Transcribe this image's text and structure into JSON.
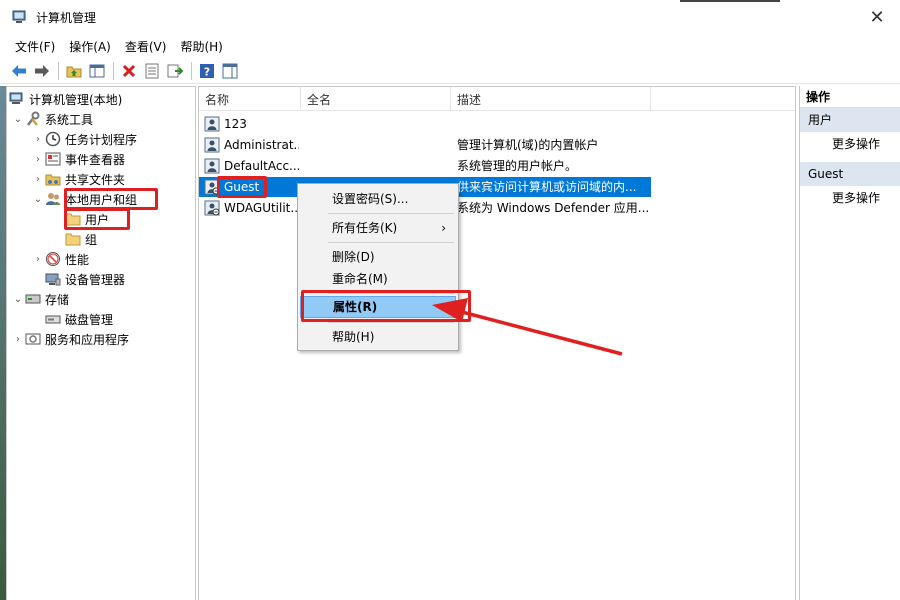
{
  "window": {
    "title": "计算机管理"
  },
  "menu": [
    "文件(F)",
    "操作(A)",
    "查看(V)",
    "帮助(H)"
  ],
  "toolbar": [
    "back-icon",
    "forward-icon",
    "up-folder-icon",
    "show-hide-tree-icon",
    "delete-icon",
    "properties-icon",
    "export-icon",
    "help-icon",
    "view-icon"
  ],
  "tree": {
    "root": "计算机管理(本地)",
    "system_tools": "系统工具",
    "task_scheduler": "任务计划程序",
    "event_viewer": "事件查看器",
    "shared_folders": "共享文件夹",
    "local_users_groups": "本地用户和组",
    "users": "用户",
    "groups": "组",
    "performance": "性能",
    "device_manager": "设备管理器",
    "storage": "存储",
    "disk_management": "磁盘管理",
    "services_apps": "服务和应用程序"
  },
  "list": {
    "columns": [
      "名称",
      "全名",
      "描述"
    ],
    "rows": [
      {
        "name": "123",
        "fullname": "",
        "desc": ""
      },
      {
        "name": "Administrat...",
        "fullname": "",
        "desc": "管理计算机(域)的内置帐户"
      },
      {
        "name": "DefaultAcc...",
        "fullname": "",
        "desc": "系统管理的用户帐户。"
      },
      {
        "name": "Guest",
        "fullname": "",
        "desc": "供来宾访问计算机或访问域的内..."
      },
      {
        "name": "WDAGUtilit...",
        "fullname": "",
        "desc": "系统为 Windows Defender 应用..."
      }
    ]
  },
  "actions": {
    "header": "操作",
    "section1": "用户",
    "more1": "更多操作",
    "section2": "Guest",
    "more2": "更多操作"
  },
  "context_menu": {
    "set_password": "设置密码(S)...",
    "all_tasks": "所有任务(K)",
    "submenu_arrow": "›",
    "delete": "删除(D)",
    "rename": "重命名(M)",
    "properties": "属性(R)",
    "help": "帮助(H)"
  },
  "colors": {
    "selection": "#0078d7",
    "highlight": "#91c9f7",
    "annotation": "#e02020"
  }
}
